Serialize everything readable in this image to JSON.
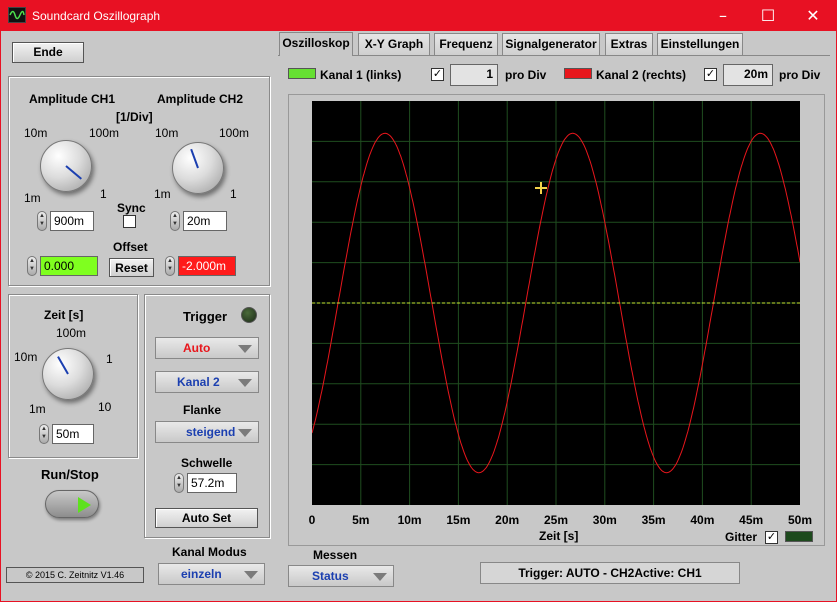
{
  "window": {
    "title": "Soundcard Oszillograph",
    "minimize_glyph": "–",
    "maximize_glyph": "☐",
    "close_glyph": "✕"
  },
  "left": {
    "ende_label": "Ende",
    "amplitude_ch1_title": "Amplitude CH1",
    "amplitude_ch2_title": "Amplitude CH2",
    "amplitude_unit": "[1/Div]",
    "ch1_ticks": {
      "t10m": "10m",
      "t100m": "100m",
      "t1m": "1m",
      "t1": "1"
    },
    "ch2_ticks": {
      "t10m": "10m",
      "t100m": "100m",
      "t1m": "1m",
      "t1": "1"
    },
    "sync_label": "Sync",
    "ch1_value": "900m",
    "ch2_value": "20m",
    "offset_label": "Offset",
    "offset_ch1_value": "0.000",
    "offset_ch2_value": "-2.000m",
    "reset_label": "Reset",
    "zeit_title": "Zeit [s]",
    "zeit_ticks": {
      "t100m": "100m",
      "t10m": "10m",
      "t1": "1",
      "t1m": "1m",
      "t10": "10"
    },
    "zeit_value": "50m",
    "runstop_label": "Run/Stop",
    "copyright": "© 2015  C. Zeitnitz V1.46",
    "kanal_modus_label": "Kanal Modus",
    "kanal_modus_value": "einzeln"
  },
  "trigger": {
    "title": "Trigger",
    "mode_value": "Auto",
    "channel_value": "Kanal 2",
    "flanke_label": "Flanke",
    "flanke_value": "steigend",
    "schwelle_label": "Schwelle",
    "schwelle_value": "57.2m",
    "autoset_label": "Auto Set"
  },
  "tabs": [
    "Oszilloskop",
    "X-Y Graph",
    "Frequenz",
    "Signalgenerator",
    "Extras",
    "Einstellungen"
  ],
  "scope_header": {
    "kanal1_label": "Kanal 1 (links)",
    "kanal1_value": "1",
    "kanal2_label": "Kanal 2 (rechts)",
    "kanal2_value": "20m",
    "pro_div_1": "pro Div",
    "pro_div_2": "pro Div",
    "kanal1_color": "#66e032",
    "kanal2_color": "#e8161c"
  },
  "scope": {
    "xlabel": "Zeit [s]",
    "xticks": [
      "0",
      "5m",
      "10m",
      "15m",
      "20m",
      "25m",
      "30m",
      "35m",
      "40m",
      "45m",
      "50m"
    ],
    "gitter_label": "Gitter"
  },
  "bottom": {
    "messen_label": "Messen",
    "messen_value": "Status",
    "status_text": "Trigger: AUTO - CH2Active: CH1"
  },
  "chart_data": {
    "type": "line",
    "xlabel": "Zeit [s]",
    "x_unit": "s",
    "xlim": [
      0,
      0.05
    ],
    "ylim": [
      -5,
      5
    ],
    "grid": true,
    "x_divisions": 10,
    "y_divisions": 10,
    "series": [
      {
        "name": "Kanal 2 (rechts)",
        "color": "#e8161c",
        "waveform": "sine",
        "frequency_hz": 52,
        "amplitude_div": 4.2,
        "phase_at_t0_deg": -50
      },
      {
        "name": "Kanal 1 (links)",
        "color": "#c8e832",
        "waveform": "flat",
        "level_div": 0,
        "style": "dashed"
      }
    ]
  }
}
